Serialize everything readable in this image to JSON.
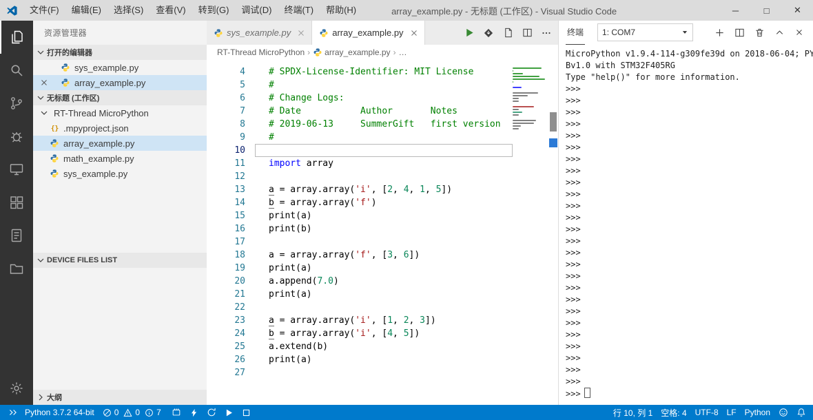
{
  "window": {
    "title": "array_example.py - 无标题 (工作区) - Visual Studio Code",
    "controls": {
      "minimize": "─",
      "maximize": "□",
      "close": "✕"
    }
  },
  "menu_bar": [
    "文件(F)",
    "编辑(E)",
    "选择(S)",
    "查看(V)",
    "转到(G)",
    "调试(D)",
    "终端(T)",
    "帮助(H)"
  ],
  "activity_bar": {
    "items": [
      {
        "icon": "files",
        "active": true
      },
      {
        "icon": "search"
      },
      {
        "icon": "source-control"
      },
      {
        "icon": "debug"
      },
      {
        "icon": "device"
      },
      {
        "icon": "extensions"
      },
      {
        "icon": "notes"
      },
      {
        "icon": "folder"
      }
    ],
    "bottom": [
      {
        "icon": "gear"
      }
    ]
  },
  "sidebar": {
    "title": "资源管理器",
    "sections": {
      "open_editors": {
        "label": "打开的编辑器",
        "items": [
          {
            "name": "sys_example.py",
            "icon": "python-file"
          },
          {
            "name": "array_example.py",
            "icon": "python-file",
            "selected": true,
            "close_visible": true
          }
        ]
      },
      "workspace": {
        "label": "无标题 (工作区)",
        "folder": {
          "name": "RT-Thread MicroPython",
          "expanded": true
        },
        "files": [
          {
            "name": ".mpyproject.json",
            "icon": "json-file"
          },
          {
            "name": "array_example.py",
            "icon": "python-file",
            "selected": true
          },
          {
            "name": "math_example.py",
            "icon": "python-file"
          },
          {
            "name": "sys_example.py",
            "icon": "python-file"
          }
        ]
      },
      "device_files": {
        "label": "DEVICE FILES LIST"
      },
      "outline": {
        "label": "大纲"
      }
    }
  },
  "editor": {
    "tabs": [
      {
        "label": "sys_example.py",
        "active": false,
        "preview": true
      },
      {
        "label": "array_example.py",
        "active": true
      }
    ],
    "actions": [
      "run",
      "flash-download",
      "open-preview",
      "split-editor",
      "more"
    ],
    "breadcrumb": [
      {
        "label": "RT-Thread MicroPython"
      },
      {
        "label": "array_example.py",
        "icon": "python-file"
      },
      {
        "label": "…"
      }
    ],
    "lines": [
      {
        "num": 4,
        "tokens": [
          {
            "t": "c",
            "s": "# SPDX-License-Identifier: MIT License"
          }
        ]
      },
      {
        "num": 5,
        "tokens": [
          {
            "t": "c",
            "s": "#"
          }
        ]
      },
      {
        "num": 6,
        "tokens": [
          {
            "t": "c",
            "s": "# Change Logs:"
          }
        ]
      },
      {
        "num": 7,
        "tokens": [
          {
            "t": "c",
            "s": "# Date           Author       Notes"
          }
        ]
      },
      {
        "num": 8,
        "tokens": [
          {
            "t": "c",
            "s": "# 2019-06-13     SummerGift   first version"
          }
        ]
      },
      {
        "num": 9,
        "tokens": [
          {
            "t": "c",
            "s": "#"
          }
        ]
      },
      {
        "num": 10,
        "tokens": [],
        "current": true
      },
      {
        "num": 11,
        "tokens": [
          {
            "t": "k",
            "s": "import"
          },
          {
            "t": "d",
            "s": " array"
          }
        ]
      },
      {
        "num": 12,
        "tokens": []
      },
      {
        "num": 13,
        "tokens": [
          {
            "t": "v",
            "s": "a"
          },
          {
            "t": "d",
            "s": " = array.array("
          },
          {
            "t": "s",
            "s": "'i'"
          },
          {
            "t": "d",
            "s": ", ["
          },
          {
            "t": "n",
            "s": "2"
          },
          {
            "t": "d",
            "s": ", "
          },
          {
            "t": "n",
            "s": "4"
          },
          {
            "t": "d",
            "s": ", "
          },
          {
            "t": "n",
            "s": "1"
          },
          {
            "t": "d",
            "s": ", "
          },
          {
            "t": "n",
            "s": "5"
          },
          {
            "t": "d",
            "s": "])"
          }
        ]
      },
      {
        "num": 14,
        "tokens": [
          {
            "t": "v",
            "s": "b"
          },
          {
            "t": "d",
            "s": " = array.array("
          },
          {
            "t": "s",
            "s": "'f'"
          },
          {
            "t": "d",
            "s": ")"
          }
        ]
      },
      {
        "num": 15,
        "tokens": [
          {
            "t": "d",
            "s": "print(a)"
          }
        ]
      },
      {
        "num": 16,
        "tokens": [
          {
            "t": "d",
            "s": "print(b)"
          }
        ]
      },
      {
        "num": 17,
        "tokens": []
      },
      {
        "num": 18,
        "tokens": [
          {
            "t": "d",
            "s": "a = array.array("
          },
          {
            "t": "s",
            "s": "'f'"
          },
          {
            "t": "d",
            "s": ", ["
          },
          {
            "t": "n",
            "s": "3"
          },
          {
            "t": "d",
            "s": ", "
          },
          {
            "t": "n",
            "s": "6"
          },
          {
            "t": "d",
            "s": "])"
          }
        ]
      },
      {
        "num": 19,
        "tokens": [
          {
            "t": "d",
            "s": "print(a)"
          }
        ]
      },
      {
        "num": 20,
        "tokens": [
          {
            "t": "d",
            "s": "a.append("
          },
          {
            "t": "n",
            "s": "7.0"
          },
          {
            "t": "d",
            "s": ")"
          }
        ]
      },
      {
        "num": 21,
        "tokens": [
          {
            "t": "d",
            "s": "print(a)"
          }
        ]
      },
      {
        "num": 22,
        "tokens": []
      },
      {
        "num": 23,
        "tokens": [
          {
            "t": "v",
            "s": "a"
          },
          {
            "t": "d",
            "s": " = array.array("
          },
          {
            "t": "s",
            "s": "'i'"
          },
          {
            "t": "d",
            "s": ", ["
          },
          {
            "t": "n",
            "s": "1"
          },
          {
            "t": "d",
            "s": ", "
          },
          {
            "t": "n",
            "s": "2"
          },
          {
            "t": "d",
            "s": ", "
          },
          {
            "t": "n",
            "s": "3"
          },
          {
            "t": "d",
            "s": "])"
          }
        ]
      },
      {
        "num": 24,
        "tokens": [
          {
            "t": "v",
            "s": "b"
          },
          {
            "t": "d",
            "s": " = array.array("
          },
          {
            "t": "s",
            "s": "'i'"
          },
          {
            "t": "d",
            "s": ", ["
          },
          {
            "t": "n",
            "s": "4"
          },
          {
            "t": "d",
            "s": ", "
          },
          {
            "t": "n",
            "s": "5"
          },
          {
            "t": "d",
            "s": "])"
          }
        ]
      },
      {
        "num": 25,
        "tokens": [
          {
            "t": "d",
            "s": "a.extend(b)"
          }
        ]
      },
      {
        "num": 26,
        "tokens": [
          {
            "t": "d",
            "s": "print(a)"
          }
        ]
      },
      {
        "num": 27,
        "tokens": []
      }
    ]
  },
  "terminal": {
    "tab": "终端",
    "selector_value": "1: COM7",
    "banner": [
      "MicroPython v1.9.4-114-g309fe39d on 2018-06-04; PY",
      "Bv1.0 with STM32F405RG",
      "Type \"help()\" for more information."
    ],
    "prompt": ">>>",
    "prompt_repeats": 26
  },
  "status_bar": {
    "left": {
      "python_version": "Python 3.7.2 64-bit",
      "errors": "0",
      "warnings": "0",
      "infos": "7"
    },
    "right": {
      "cursor_position": "行 10, 列 1",
      "indentation": "空格: 4",
      "encoding": "UTF-8",
      "eol": "LF",
      "language": "Python"
    }
  },
  "colors": {
    "status_bar": "#007acc",
    "activity_bar": "#333333",
    "selection": "#cfe4f5",
    "comment": "#008000",
    "keyword": "#0000ff",
    "string": "#a31515",
    "number": "#098658"
  }
}
